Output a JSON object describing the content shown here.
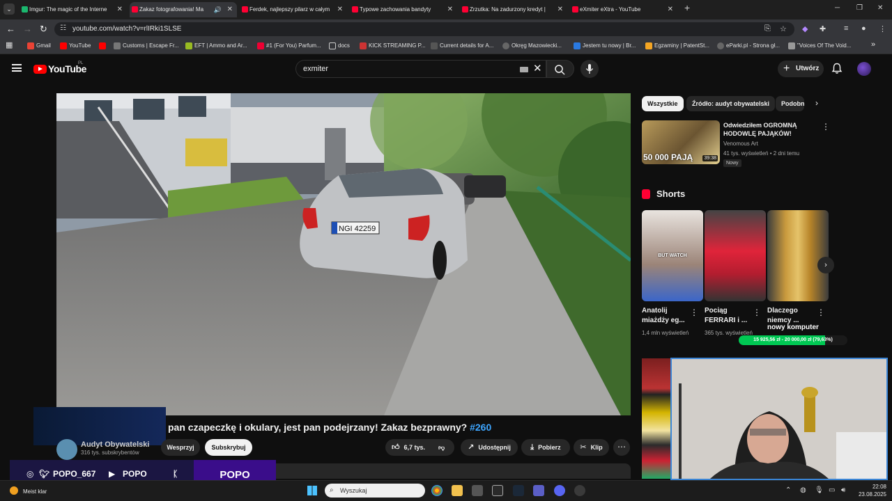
{
  "browser": {
    "tabs": [
      {
        "title": "Imgur: The magic of the Interne",
        "color": "#1bb76e",
        "active": false
      },
      {
        "title": "Zakaz fotografowania! Ma",
        "color": "#ff0033",
        "active": true
      },
      {
        "title": "Ferdek, najlepszy pilarz w całym",
        "color": "#ff0033",
        "active": false
      },
      {
        "title": "Typowe zachowania bandyty",
        "color": "#ff0033",
        "active": false
      },
      {
        "title": "Zrzutka: Na zadurzony kredyt |",
        "color": "#ff0033",
        "active": false
      },
      {
        "title": "eXmiter eXtra - YouTube",
        "color": "#ff0033",
        "active": false
      }
    ],
    "url": "youtube.com/watch?v=rlIRki1SLSE",
    "bookmarks": [
      "Gmail",
      "YouTube",
      "",
      "Customs | Escape Fr...",
      "EFT | Ammo and Ar...",
      "#1 (For You) Parfum...",
      "docs",
      "KICK STREAMING P...",
      "Current details for A...",
      "Okręg Mazowiecki...",
      "Jestem tu nowy | Br...",
      "Egzaminy | PatentSt...",
      "eParki.pl - Strona gł...",
      "\"Voices Of The Void..."
    ]
  },
  "youtube": {
    "logo_text": "YouTube",
    "country_code": "PL",
    "search_value": "exmiter",
    "create_label": "Utwórz",
    "video": {
      "plate": "NGI 42259",
      "title": "pan czapeczkę i okulary, jest pan podejrzany! Zakaz bezprawny?",
      "hashtag": "#260",
      "channel_name": "Audyt Obywatelski",
      "subscribers": "316 tys. subskrybentów",
      "support_label": "Wesprzyj",
      "subscribe_label": "Subskrybuj",
      "likes": "6,7 tys.",
      "share_label": "Udostępnij",
      "download_label": "Pobierz",
      "clip_label": "Klip"
    },
    "chips": [
      "Wszystkie",
      "Źródło: audyt obywatelski",
      "Podobne"
    ],
    "recommended": {
      "title": "Odwiedziłem OGROMNĄ HODOWLĘ PAJĄKÓW!",
      "thumb_text": "50 000 PAJĄ",
      "duration": "39:38",
      "channel": "Venomous Art",
      "meta": "41 tys. wyświetleń • 2 dni temu",
      "badge": "Nowy"
    },
    "shorts_heading": "Shorts",
    "shorts": [
      {
        "title": "Anatolij miażdży eg...",
        "views": "1,4 mln wyświetleń",
        "caption": "BUT WATCH"
      },
      {
        "title": "Pociąg FERRARI i ...",
        "views": "365 tys. wyświetleń",
        "caption": ""
      },
      {
        "title": "Dlaczego niemcy ...",
        "views": "",
        "caption": ""
      }
    ],
    "donation_text": "15 925,56 zł - 20 000,00 zł (79,63%)",
    "donation_progress": 0.7963,
    "donation_note": "nowy komputer"
  },
  "stream_overlay": {
    "instagram": "POPO_667",
    "youtube": "POPO",
    "kick": "POPO"
  },
  "taskbar": {
    "weather": "Meist klar",
    "search_placeholder": "Wyszukaj",
    "time": "22:08",
    "date": "23.08.2025"
  }
}
